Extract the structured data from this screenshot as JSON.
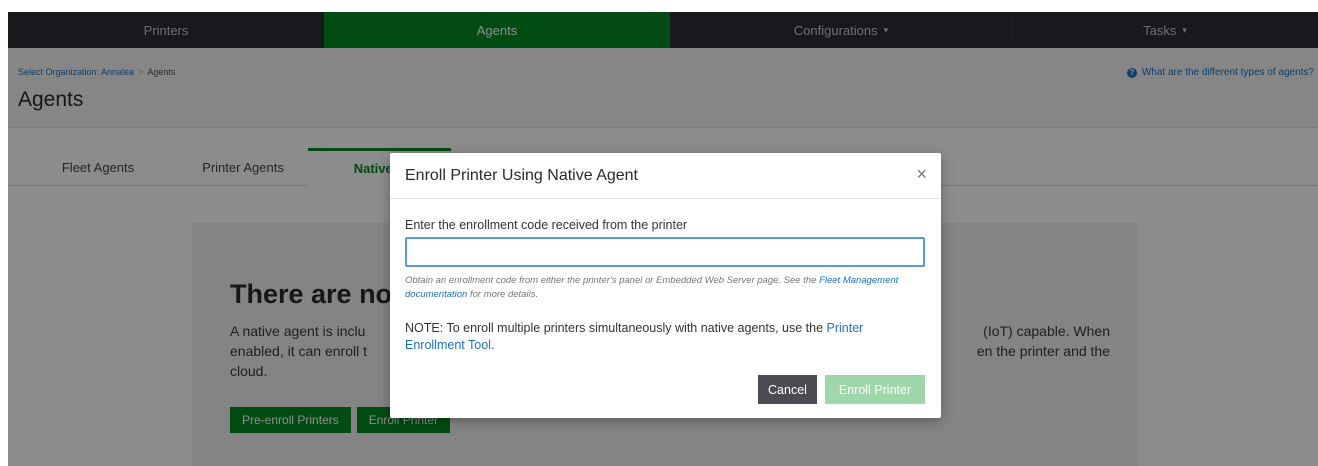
{
  "nav": {
    "items": [
      {
        "label": "Printers",
        "caret": ""
      },
      {
        "label": "Agents",
        "caret": ""
      },
      {
        "label": "Configurations",
        "caret": "▾"
      },
      {
        "label": "Tasks",
        "caret": "▾"
      }
    ],
    "active_index": 1,
    "accent_color": "#008a22"
  },
  "header": {
    "breadcrumb": {
      "org_link": "Select Organization: Annalea",
      "separator": ">",
      "current": "Agents"
    },
    "title": "Agents",
    "help_link": "What are the different types of agents?",
    "help_icon": "question-circle-icon"
  },
  "tabs": {
    "items": [
      "Fleet Agents",
      "Printer Agents",
      "Native A"
    ],
    "active_index": 2
  },
  "empty_state": {
    "heading": "There are no",
    "text_left_1": "A native agent is inclu",
    "text_right_1": "(IoT) capable. When",
    "text_left_2": "enabled, it can enroll t",
    "text_right_2": "en the printer and the",
    "text_left_3": "cloud.",
    "preenroll_button": "Pre-enroll Printers",
    "enroll_button": "Enroll Printer"
  },
  "modal": {
    "title": "Enroll Printer Using Native Agent",
    "close_symbol": "×",
    "field_label": "Enter the enrollment code received from the printer",
    "field_value": "",
    "hint_prefix": "Obtain an enrollment code from either the printer's panel or Embedded Web Server page. See the ",
    "hint_link": "Fleet Management documentation",
    "hint_suffix": " for more details.",
    "note_prefix": "NOTE: To enroll multiple printers simultaneously with native agents, use the ",
    "note_link": "Printer Enrollment Tool",
    "note_suffix": ".",
    "cancel_button": "Cancel",
    "enroll_button": "Enroll Printer",
    "enroll_disabled": true
  }
}
